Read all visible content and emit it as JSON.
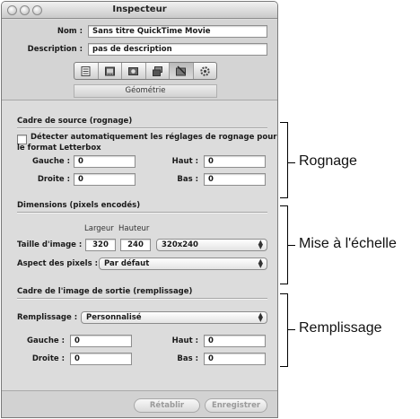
{
  "window": {
    "title": "Inspecteur"
  },
  "header": {
    "name_label": "Nom :",
    "name_value": "Sans titre QuickTime Movie",
    "description_label": "Description :",
    "description_value": "pas de description",
    "tabs": [
      {
        "icon": "summary-icon"
      },
      {
        "icon": "video-icon"
      },
      {
        "icon": "encoder-icon"
      },
      {
        "icon": "frame-controls-icon"
      },
      {
        "icon": "geometry-icon",
        "active": true
      },
      {
        "icon": "actions-icon"
      }
    ],
    "tab_subtitle": "Géométrie"
  },
  "crop_section": {
    "title": "Cadre de source (rognage)",
    "auto_detect_label_line1": "Détecter automatiquement les réglages de rognage pour",
    "auto_detect_label_line2": "le format Letterbox",
    "auto_detect_checked": false,
    "left_label": "Gauche :",
    "left_value": "0",
    "top_label": "Haut :",
    "top_value": "0",
    "right_label": "Droite :",
    "right_value": "0",
    "bottom_label": "Bas :",
    "bottom_value": "0"
  },
  "dimensions_section": {
    "title": "Dimensions (pixels encodés)",
    "width_header": "Largeur",
    "height_header": "Hauteur",
    "frame_size_label": "Taille d'image :",
    "width_value": "320",
    "height_value": "240",
    "size_preset": "320x240",
    "pixel_aspect_label": "Aspect des pixels :",
    "pixel_aspect_value": "Par défaut"
  },
  "output_section": {
    "title": "Cadre de l'image de sortie (remplissage)",
    "padding_label": "Remplissage :",
    "padding_value": "Personnalisé",
    "left_label": "Gauche :",
    "left_value": "0",
    "top_label": "Haut :",
    "top_value": "0",
    "right_label": "Droite :",
    "right_value": "0",
    "bottom_label": "Bas :",
    "bottom_value": "0"
  },
  "footer": {
    "revert_label": "Rétablir",
    "save_label": "Enregistrer"
  },
  "annotations": {
    "cropping": "Rognage",
    "scaling": "Mise à l'échelle",
    "padding": "Remplissage"
  }
}
